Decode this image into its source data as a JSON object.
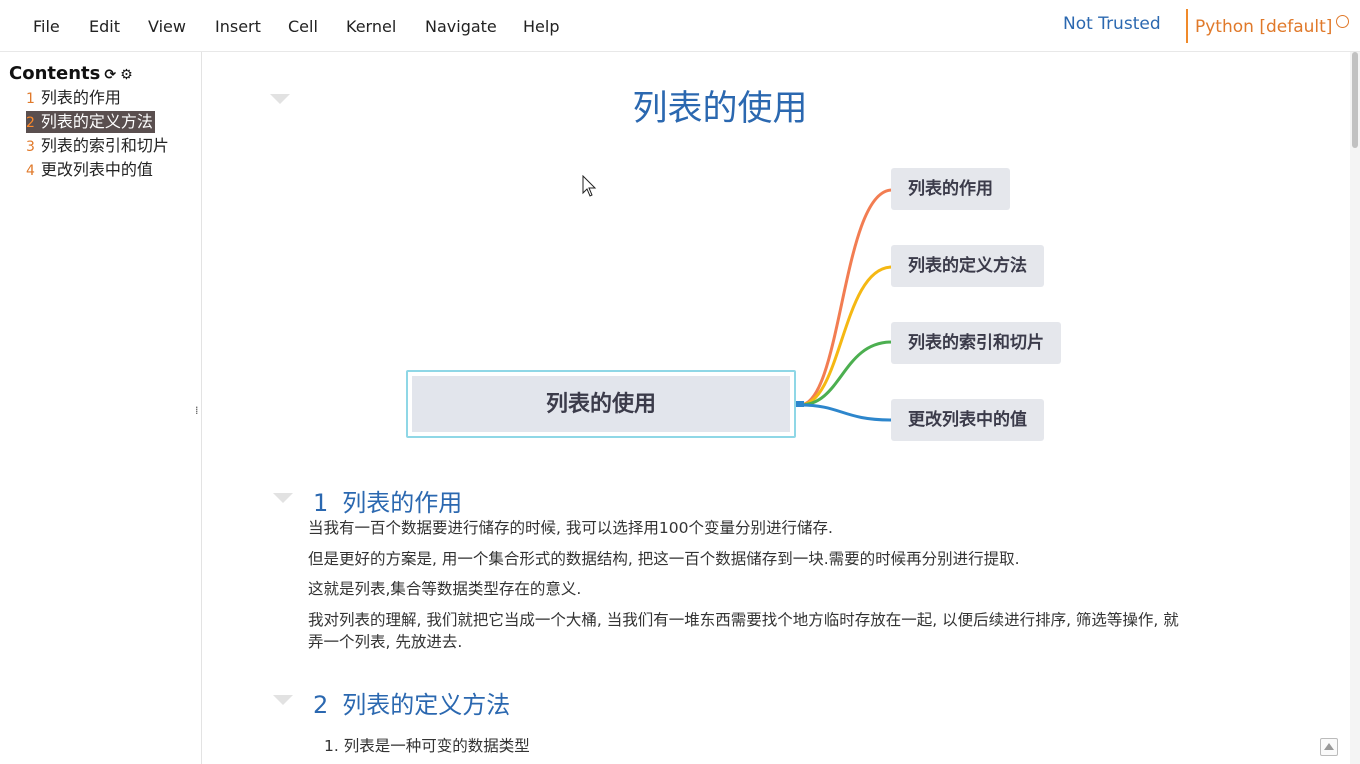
{
  "menubar": {
    "menus": [
      "File",
      "Edit",
      "View",
      "Insert",
      "Cell",
      "Kernel",
      "Navigate",
      "Help"
    ],
    "trusted": "Not Trusted",
    "kernel": "Python [default]"
  },
  "toc": {
    "title": "Contents",
    "items": [
      {
        "num": "1",
        "label": "列表的作用"
      },
      {
        "num": "2",
        "label": "列表的定义方法"
      },
      {
        "num": "3",
        "label": "列表的索引和切片"
      },
      {
        "num": "4",
        "label": "更改列表中的值"
      }
    ]
  },
  "doc": {
    "title": "列表的使用",
    "mindmap": {
      "center": "列表的使用",
      "branches": [
        "列表的作用",
        "列表的定义方法",
        "列表的索引和切片",
        "更改列表中的值"
      ],
      "colors": [
        "#f27d52",
        "#f5b813",
        "#4caf50",
        "#2d86cc"
      ]
    },
    "sections": [
      {
        "num": "1",
        "title": "列表的作用",
        "paragraphs": [
          "当我有一百个数据要进行储存的时候, 我可以选择用100个变量分别进行储存.",
          "但是更好的方案是, 用一个集合形式的数据结构, 把这一百个数据储存到一块.需要的时候再分别进行提取.",
          "这就是列表,集合等数据类型存在的意义.",
          "我对列表的理解, 我们就把它当成一个大桶, 当我们有一堆东西需要找个地方临时存放在一起, 以便后续进行排序, 筛选等操作, 就弄一个列表, 先放进去."
        ]
      },
      {
        "num": "2",
        "title": "列表的定义方法",
        "list": [
          "列表是一种可变的数据类型"
        ]
      }
    ]
  }
}
